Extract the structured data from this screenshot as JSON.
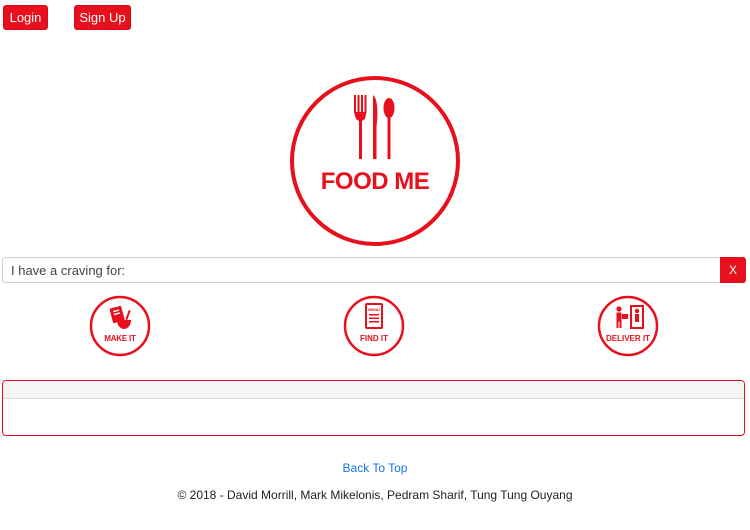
{
  "header": {
    "login_label": "Login",
    "signup_label": "Sign Up"
  },
  "logo": {
    "text": "FOOD ME"
  },
  "search": {
    "value": "I have a craving for:",
    "clear_label": "X"
  },
  "modes": [
    {
      "label": "MAKE IT",
      "icon": "recipe-bowl-icon"
    },
    {
      "label": "FIND IT",
      "icon": "menu-icon"
    },
    {
      "label": "DELIVER IT",
      "icon": "delivery-person-icon"
    }
  ],
  "footer": {
    "back_to_top": "Back To Top",
    "copyright": "© 2018 - David Morrill, Mark Mikelonis, Pedram Sharif, Tung Tung Ouyang"
  },
  "colors": {
    "brand_red": "#e8101c",
    "link_blue": "#1a73e8"
  }
}
